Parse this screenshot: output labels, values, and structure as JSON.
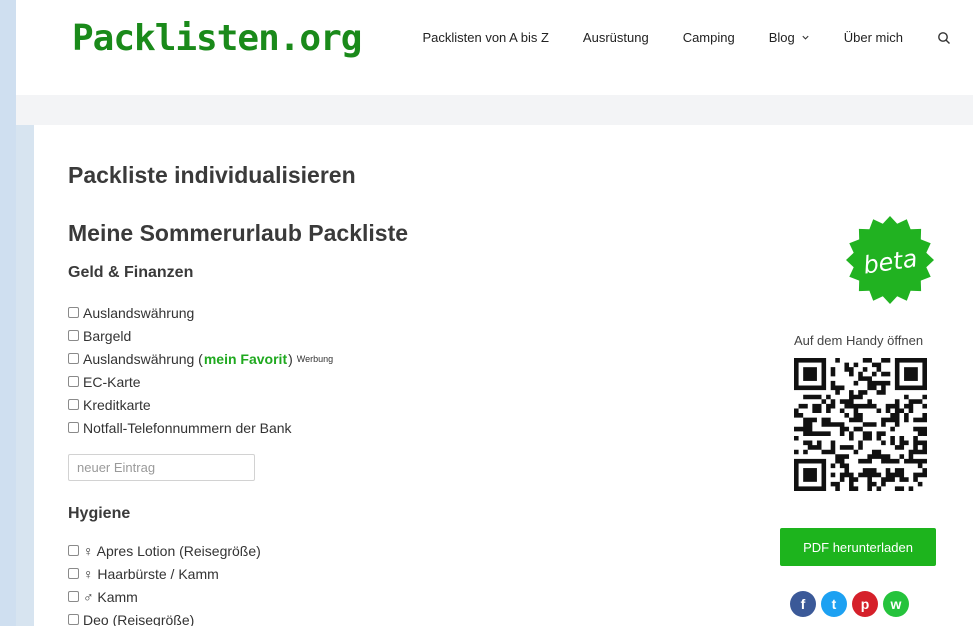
{
  "header": {
    "logo": "Packlisten.org",
    "nav": [
      "Packlisten von A bis Z",
      "Ausrüstung",
      "Camping",
      "Blog",
      "Über mich"
    ]
  },
  "page": {
    "title": "Packliste individualisieren",
    "list_title": "Meine Sommerurlaub Packliste"
  },
  "sections": [
    {
      "title": "Geld & Finanzen",
      "items": [
        "Auslandswährung",
        "Bargeld",
        "Auslandswährung",
        "EC-Karte",
        "Kreditkarte",
        "Notfall-Telefonnummern der Bank"
      ],
      "favorite_text": "mein Favorit",
      "ad_label": "Werbung",
      "new_entry_placeholder": "neuer Eintrag"
    },
    {
      "title": "Hygiene",
      "items": [
        "♀ Apres Lotion (Reisegröße)",
        "♀ Haarbürste / Kamm",
        "♂ Kamm",
        "Deo (Reisegröße)"
      ]
    }
  ],
  "sidebar": {
    "beta_label": "beta",
    "handy_label": "Auf dem Handy öffnen",
    "pdf_button": "PDF herunterladen",
    "social": [
      {
        "name": "facebook",
        "glyph": "f",
        "color": "#3b5998"
      },
      {
        "name": "twitter",
        "glyph": "t",
        "color": "#1da1f2"
      },
      {
        "name": "pinterest",
        "glyph": "p",
        "color": "#d5202a"
      },
      {
        "name": "whatsapp",
        "glyph": "w",
        "color": "#25c33c"
      }
    ]
  },
  "colors": {
    "brand_green": "#1a8a1a",
    "button_green": "#1db41d",
    "link_green": "#1fa91f"
  }
}
